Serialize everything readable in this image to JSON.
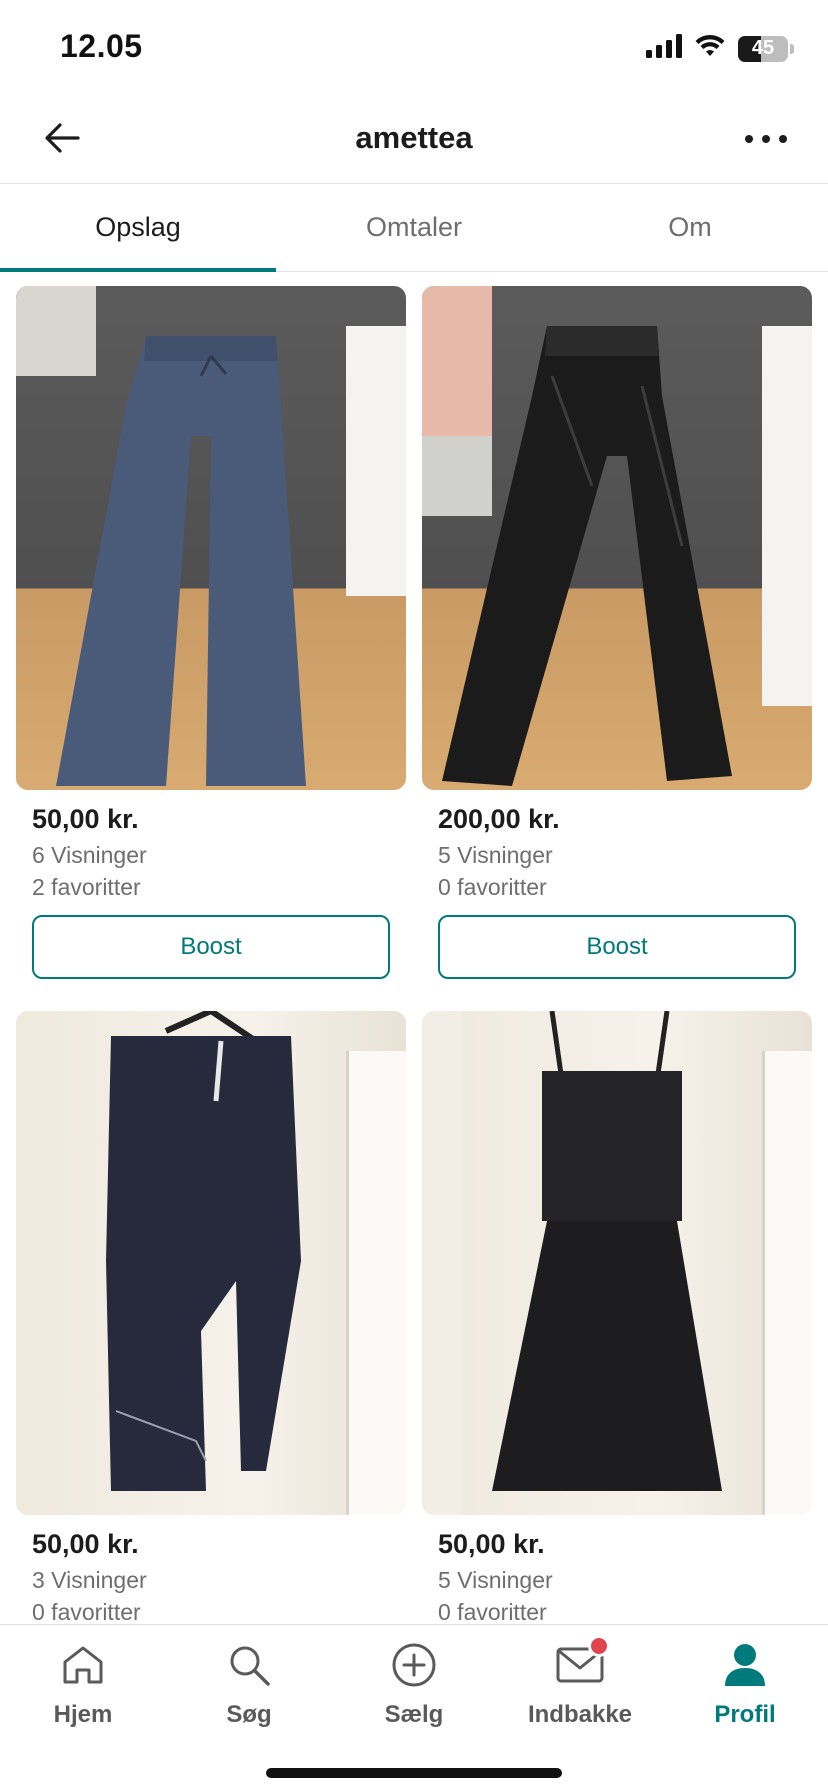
{
  "status": {
    "time": "12.05",
    "battery": "45",
    "icons": [
      "signal-icon",
      "wifi-icon",
      "battery-icon"
    ]
  },
  "header": {
    "title": "amettea",
    "back_icon": "arrow-left-icon",
    "more_icon": "more-horizontal-icon"
  },
  "tabs": [
    {
      "label": "Opslag",
      "active": true
    },
    {
      "label": "Omtaler",
      "active": false
    },
    {
      "label": "Om",
      "active": false
    }
  ],
  "listings": [
    {
      "price": "50,00 kr.",
      "views": "6 Visninger",
      "favorites": "2 favoritter",
      "boost_label": "Boost",
      "image": "blue flared trousers on floor"
    },
    {
      "price": "200,00 kr.",
      "views": "5 Visninger",
      "favorites": "0 favoritter",
      "boost_label": "Boost",
      "image": "black leather trousers on floor"
    },
    {
      "price": "50,00 kr.",
      "views": "3 Visninger",
      "favorites": "0 favoritter",
      "image": "navy track pants on hanger"
    },
    {
      "price": "50,00 kr.",
      "views": "5 Visninger",
      "favorites": "0 favoritter",
      "image": "black dress on hanger"
    }
  ],
  "bottom_nav": [
    {
      "label": "Hjem",
      "icon": "home-icon",
      "active": false
    },
    {
      "label": "Søg",
      "icon": "search-icon",
      "active": false
    },
    {
      "label": "Sælg",
      "icon": "plus-circle-icon",
      "active": false
    },
    {
      "label": "Indbakke",
      "icon": "mail-icon",
      "active": false,
      "badge": true
    },
    {
      "label": "Profil",
      "icon": "profile-icon",
      "active": true
    }
  ],
  "colors": {
    "accent": "#007a7a",
    "badge": "#e0454f",
    "text": "#1c1c1c",
    "muted": "#6e6e6e"
  }
}
